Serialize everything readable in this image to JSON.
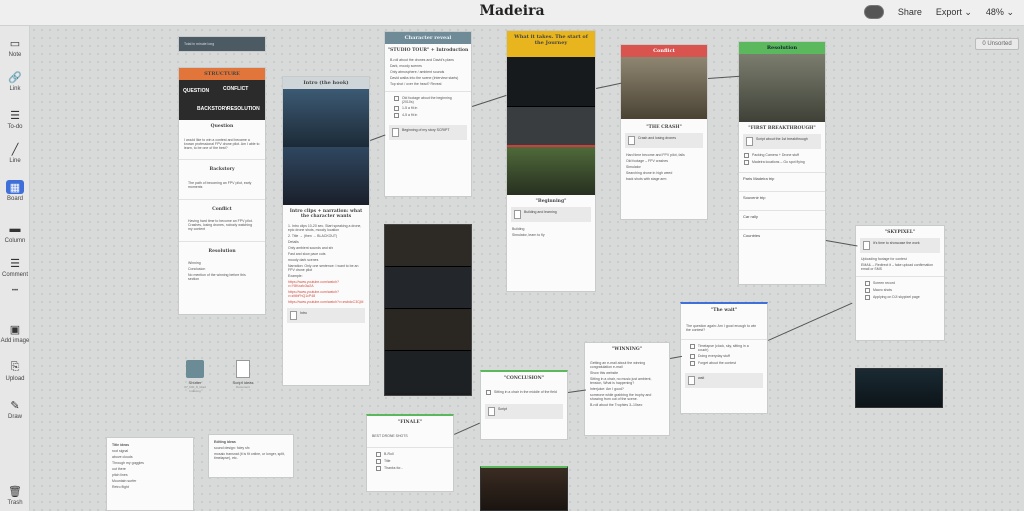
{
  "header": {
    "title": "Madeira",
    "share": "Share",
    "export": "Export",
    "zoom": "48%"
  },
  "unsorted": "0 Unsorted",
  "sidebar": [
    "Note",
    "Link",
    "To-do",
    "Line",
    "Board",
    "Column",
    "Comment",
    "•••",
    "Add image",
    "Upload",
    "Draw",
    "Trash"
  ],
  "structure": {
    "top": "Total in minute long",
    "title": "STRUCTURE",
    "diagram": {
      "question": "QUESTION",
      "conflict": "CONFLICT",
      "backstory": "BACKSTORY",
      "resolution": "RESOLUTION"
    },
    "question": "Question",
    "question_text": "I would like to win a contest and became a known professional FPV drone pilot. Am I able to learn, to be one of the best?",
    "backstory": "Backstory",
    "backstory_text": "The path of becoming an FPV pilot, early moments",
    "conflict": "Conflict",
    "conflict_text": "Having hard time to become an FPV pilot. Crashes, losing drones, nobody watching my content",
    "resolution": "Resolution",
    "res_items": [
      "Winning",
      "Conclusion",
      "No mention of the winning before this section"
    ]
  },
  "intro": {
    "col": "Intro (the hook)",
    "title": "Intro clips + narration: what the character wants",
    "lines": [
      "1. Intro clips 10-20 sec. Start speaking a drone, epic drone shots, moody location",
      "2. Title → (then → BLACKOUT)",
      "Details",
      "Only ambient sounds and sfx",
      "Fast and slow pace cuts",
      "moody dark scenes",
      "Narration: Only one sentence: I want to be an FPV drone pilot",
      "Example:"
    ],
    "links": [
      "https://www.youtube.com/watch?v=Y8Kxafc3w2A",
      "https://www.youtube.com/watch?v=zMbFhQ1cP48",
      "https://www.youtube.com/watch?v=zwbdcC3CjM"
    ],
    "doc": "Intro"
  },
  "reveal": {
    "col": "Character reveal",
    "title": "\"STUDIO TOUR\" + Introduction",
    "lines": [
      "B-roll about the drones and David's plans",
      "Dark, moody scenes",
      "Only atmosphere / ambient sounds",
      "David walks into the scene (Interview starts)",
      "Top shot / over the head? Reveal"
    ],
    "checks": [
      "Old footage about the beginning (2010s)",
      "1-5 a fit in",
      "4-5 a fit in"
    ],
    "doc": "Beginning of my story SCRIPT"
  },
  "journey": {
    "col": "What it takes. The start of the Journey",
    "title": "\"Beginning\"",
    "doc": "Building and learning",
    "items": [
      "Building",
      "Simulator, learn to fly"
    ]
  },
  "conflict": {
    "col": "Conflict",
    "title": "\"THE CRASH\"",
    "doc": "Crash and losing drones",
    "intro": "Hard time become and FPV pilot, fails",
    "items": [
      "Old footage – FPV crashes",
      "Simulator",
      "Searching drone in high weed",
      "back shots with stage arm"
    ]
  },
  "resolution": {
    "col": "Resolution",
    "title": "\"FIRST BREAKTHROUGH\"",
    "doc": "Script about the 1st breakthrough",
    "checks": [
      "Packing Camera + Drone stuff",
      "Madeira locations – Go spot flying"
    ],
    "rows": [
      "Paris Madeira trip",
      "Souvenir trip",
      "Car rally",
      "Countries"
    ]
  },
  "skypixel": {
    "title": "\"SKYPIXEL\"",
    "doc": "It's time to showcase the work",
    "text": "Uploading footage for contest",
    "text2": "EMAIL – Redirect it – fake upload confirmation email or SMS",
    "checks": [
      "Screen record",
      "Macro shots",
      "Applying on DJI skypixel page"
    ]
  },
  "wait": {
    "title": "\"The wait\"",
    "text": "The question again: Am I good enough to win the contest?",
    "checks": [
      "Timelapse (clock, sky, sitting in a couch)",
      "Doing everyday stuff",
      "Forget about the contest"
    ],
    "doc": "wait"
  },
  "winning": {
    "title": "\"WINNING\"",
    "lines": [
      "Getting an e-mail about the winning congratulation e-mail",
      "Show this website",
      "Sitting in a chair, no music just ambient, tension, What is happening?",
      "Interjuice: Am I good?",
      "someone while grabbing the trophy and showing from out of the scene.",
      "B-roll about the Trophies 3–10sec"
    ]
  },
  "conclusion": {
    "title": "\"CONCLUSION\"",
    "check": "Sitting in a chair in the middle of the field",
    "doc": "Script"
  },
  "finale": {
    "title": "\"FINALE\"",
    "text": "BEST DRONE SHOTS",
    "checks": [
      "B-Roll",
      "Title",
      "Thanks for..."
    ]
  },
  "files": [
    {
      "name": "Shutter",
      "meta": "07_b00_8_Glad Indexing"
    },
    {
      "name": "Script ideas",
      "meta": "Document"
    }
  ],
  "title_ideas": {
    "head": "Title ideas",
    "items": [
      "root signal",
      "above clouds",
      "Through my goggles",
      "out there",
      "pitch lines",
      "Mountain surfer",
      "Retro flight"
    ]
  },
  "editing": {
    "head": "Editing ideas",
    "lines": [
      "sound design: foley sfx",
      "mosaic transnat (it is fit online, ur longer, split, timelapse), etc."
    ]
  }
}
